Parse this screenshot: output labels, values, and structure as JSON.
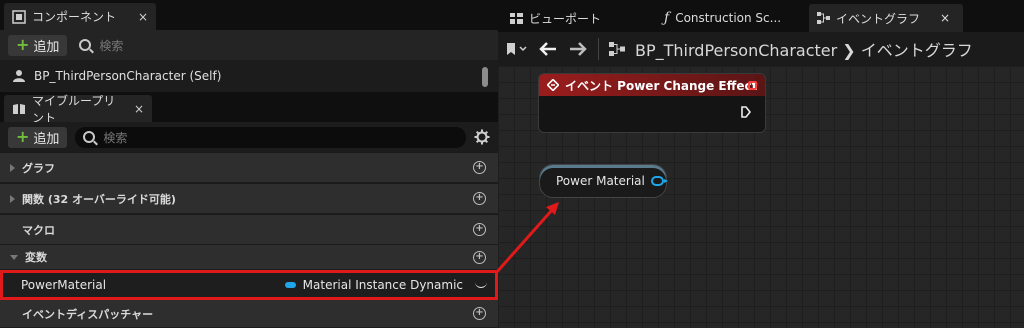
{
  "components_panel": {
    "tab_label": "コンポーネント",
    "close_label": "×",
    "add_label": "追加",
    "search_placeholder": "検索",
    "self_item": "BP_ThirdPersonCharacter (Self)"
  },
  "my_blueprint_panel": {
    "tab_label": "マイブループリント",
    "close_label": "×",
    "add_label": "追加",
    "search_placeholder": "検索",
    "categories": [
      {
        "label": "グラフ"
      },
      {
        "label": "関数 (32 オーバーライド可能)"
      },
      {
        "label": "マクロ"
      },
      {
        "label": "変数"
      },
      {
        "label": "イベントディスパッチャー"
      }
    ],
    "variable": {
      "name": "PowerMaterial",
      "type": "Material Instance Dynamic",
      "type_color": "#1fa6e8"
    }
  },
  "editor_tabs": [
    {
      "label": "ビューポート",
      "icon": "viewport-grid-icon"
    },
    {
      "label": "Construction Sc...",
      "icon": "function-icon"
    },
    {
      "label": "イベントグラフ",
      "icon": "event-graph-icon",
      "close_label": "×"
    }
  ],
  "breadcrumb": {
    "blueprint": "BP_ThirdPersonCharacter",
    "separator": "❯",
    "graph": "イベントグラフ"
  },
  "graph": {
    "event_node": {
      "title": "イベント Power Change Effect",
      "header_color": "#9b1d1d"
    },
    "variable_node": {
      "label": "Power Material",
      "pin_color": "#1fa6e8"
    },
    "highlight_color": "#e01a1a"
  }
}
